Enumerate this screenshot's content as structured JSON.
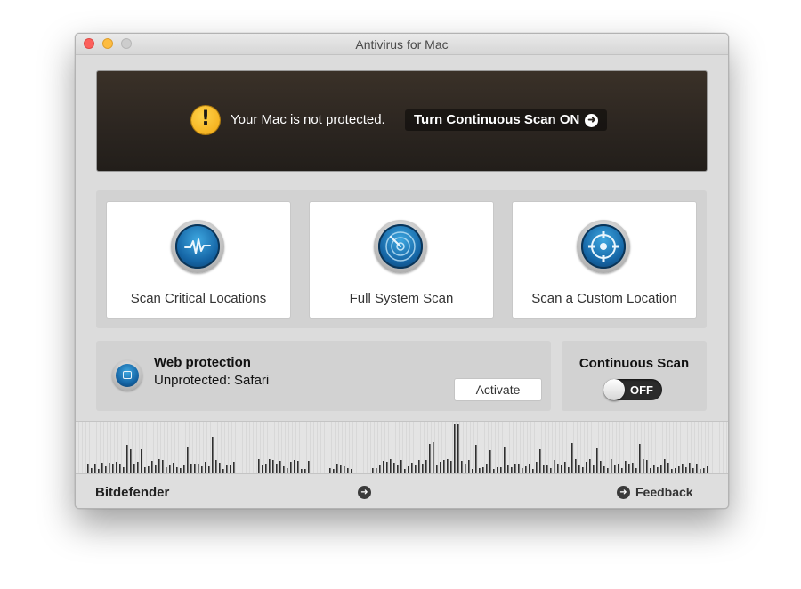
{
  "window": {
    "title": "Antivirus for Mac"
  },
  "banner": {
    "message": "Your Mac is not protected.",
    "action_label": "Turn Continuous Scan ON",
    "warning_glyph": "!",
    "arrow_glyph": "➜"
  },
  "scans": [
    {
      "label": "Scan Critical Locations",
      "icon": "pulse-icon"
    },
    {
      "label": "Full System Scan",
      "icon": "radar-icon"
    },
    {
      "label": "Scan a Custom Location",
      "icon": "target-icon"
    }
  ],
  "web_protection": {
    "title": "Web protection",
    "status": "Unprotected: Safari",
    "button_label": "Activate"
  },
  "continuous_scan": {
    "title": "Continuous Scan",
    "toggle_label": "OFF",
    "enabled": false
  },
  "footer": {
    "brand": "Bitdefender",
    "feedback_label": "Feedback",
    "arrow_glyph": "➜"
  },
  "colors": {
    "accent_blue": "#1565a5",
    "warning_yellow": "#f2a711",
    "banner_dark": "#2b2520"
  }
}
